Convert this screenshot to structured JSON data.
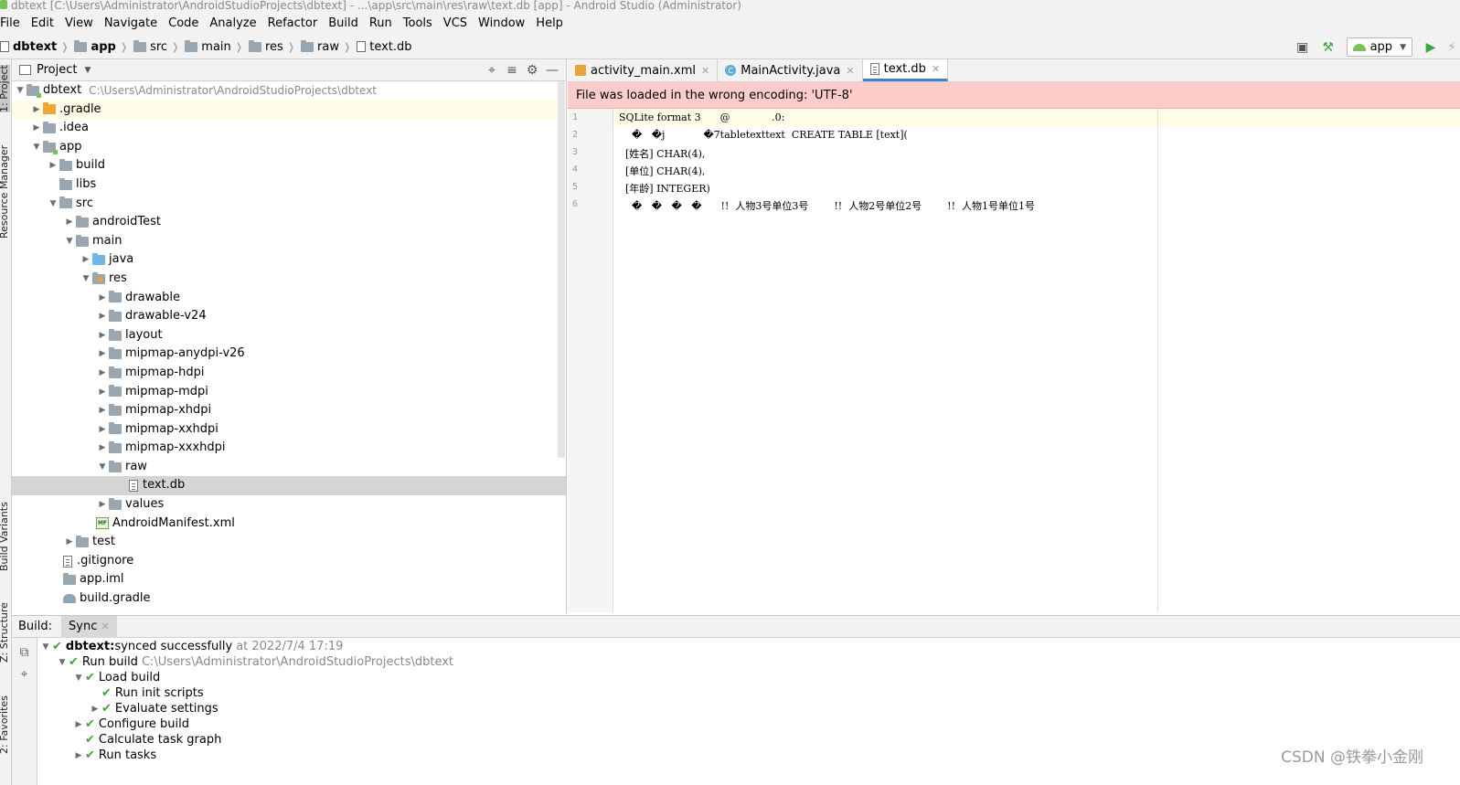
{
  "window": {
    "title": "dbtext [C:\\Users\\Administrator\\AndroidStudioProjects\\dbtext] - ...\\app\\src\\main\\res\\raw\\text.db [app] - Android Studio (Administrator)"
  },
  "menu": [
    "File",
    "Edit",
    "View",
    "Navigate",
    "Code",
    "Analyze",
    "Refactor",
    "Build",
    "Run",
    "Tools",
    "VCS",
    "Window",
    "Help"
  ],
  "breadcrumbs": [
    "dbtext",
    "app",
    "src",
    "main",
    "res",
    "raw",
    "text.db"
  ],
  "run_config": "app",
  "left_stripe": [
    "1: Project",
    "Resource Manager",
    "Build Variants",
    "Z: Structure",
    "2: Favorites"
  ],
  "project_panel": {
    "title": "Project",
    "root_path": "C:\\Users\\Administrator\\AndroidStudioProjects\\dbtext",
    "tree": [
      {
        "label": "dbtext"
      },
      {
        "label": ".gradle"
      },
      {
        "label": ".idea"
      },
      {
        "label": "app"
      },
      {
        "label": "build"
      },
      {
        "label": "libs"
      },
      {
        "label": "src"
      },
      {
        "label": "androidTest"
      },
      {
        "label": "main"
      },
      {
        "label": "java"
      },
      {
        "label": "res"
      },
      {
        "label": "drawable"
      },
      {
        "label": "drawable-v24"
      },
      {
        "label": "layout"
      },
      {
        "label": "mipmap-anydpi-v26"
      },
      {
        "label": "mipmap-hdpi"
      },
      {
        "label": "mipmap-mdpi"
      },
      {
        "label": "mipmap-xhdpi"
      },
      {
        "label": "mipmap-xxhdpi"
      },
      {
        "label": "mipmap-xxxhdpi"
      },
      {
        "label": "raw"
      },
      {
        "label": "text.db"
      },
      {
        "label": "values"
      },
      {
        "label": "AndroidManifest.xml"
      },
      {
        "label": "test"
      },
      {
        "label": ".gitignore"
      },
      {
        "label": "app.iml"
      },
      {
        "label": "build.gradle"
      }
    ]
  },
  "editor": {
    "tabs": [
      "activity_main.xml",
      "MainActivity.java",
      "text.db"
    ],
    "banner": "File was loaded in the wrong encoding: 'UTF-8'",
    "lines": [
      {
        "num": "1",
        "text": "SQLite format 3      @             .0:"
      },
      {
        "num": "2",
        "text": "    �   �j            �7tabletexttext  CREATE TABLE [text]("
      },
      {
        "num": "3",
        "text": "  [姓名] CHAR(4),"
      },
      {
        "num": "4",
        "text": "  [单位] CHAR(4),"
      },
      {
        "num": "5",
        "text": "  [年龄] INTEGER)"
      },
      {
        "num": "6",
        "text": "    �   �   �   �      !!  人物3号单位3号        !!  人物2号单位2号        !!  人物1号单位1号"
      }
    ]
  },
  "build_panel": {
    "label": "Build:",
    "tab": "Sync",
    "rows": [
      {
        "bold": "dbtext:",
        "text": " synced successfully",
        "dim": "at 2022/7/4 17:19"
      },
      {
        "bold": "",
        "text": "Run build",
        "dim": "C:\\Users\\Administrator\\AndroidStudioProjects\\dbtext"
      },
      {
        "bold": "",
        "text": "Load build",
        "dim": ""
      },
      {
        "bold": "",
        "text": "Run init scripts",
        "dim": ""
      },
      {
        "bold": "",
        "text": "Evaluate settings",
        "dim": ""
      },
      {
        "bold": "",
        "text": "Configure build",
        "dim": ""
      },
      {
        "bold": "",
        "text": "Calculate task graph",
        "dim": ""
      },
      {
        "bold": "",
        "text": "Run tasks",
        "dim": ""
      }
    ]
  },
  "watermark": "CSDN @铁拳小金刚"
}
